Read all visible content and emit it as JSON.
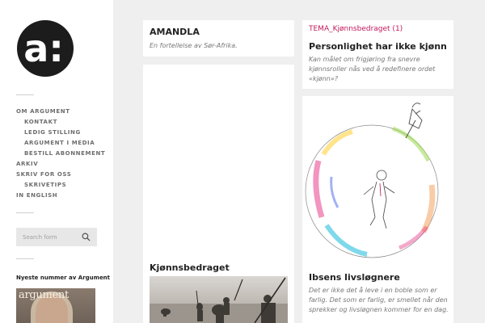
{
  "logo": {
    "text": "a:",
    "icon": "argument-logo-icon"
  },
  "nav": {
    "items": [
      {
        "label": "OM ARGUMENT",
        "sub": false
      },
      {
        "label": "KONTAKT",
        "sub": true
      },
      {
        "label": "LEDIG STILLING",
        "sub": true
      },
      {
        "label": "ARGUMENT I MEDIA",
        "sub": true
      },
      {
        "label": "BESTILL ABONNEMENT",
        "sub": true
      },
      {
        "label": "ARKIV",
        "sub": false
      },
      {
        "label": "SKRIV FOR OSS",
        "sub": false
      },
      {
        "label": "SKRIVETIPS",
        "sub": true
      },
      {
        "label": "IN ENGLISH",
        "sub": false
      }
    ]
  },
  "search": {
    "placeholder": "Search form",
    "icon": "search-icon"
  },
  "issue": {
    "label": "Nyeste nummer av Argument",
    "cover_title": "argument"
  },
  "cards": {
    "amandla": {
      "title": "AMANDLA",
      "subtitle": "En fortellelse av Sør-Afrika."
    },
    "kjonnsbedraget": {
      "title": "Kjønnsbedraget"
    },
    "personlighet": {
      "tag": "TEMA_Kjønnsbedraget (1)",
      "title": "Personlighet har ikke kjønn",
      "subtitle": "Kan målet om frigjøring fra snevre kjønnsroller nås ved å redefinere ordet «kjønn»?"
    },
    "ibsen": {
      "title": "Ibsens livsløgnere",
      "subtitle": "Det er ikke det å leve i en boble som er farlig. Det som er farlig, er smellet når den sprekker og livsløgnen kommer for en dag."
    }
  },
  "colors": {
    "tag": "#c2185b",
    "logo_bg": "#1c1c1c",
    "page_bg": "#efefef"
  }
}
